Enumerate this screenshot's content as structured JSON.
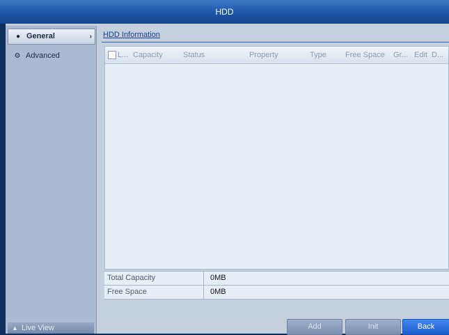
{
  "window": {
    "title": "HDD"
  },
  "sidebar": {
    "items": [
      {
        "label": "General",
        "icon": "dot-icon",
        "active": true
      },
      {
        "label": "Advanced",
        "icon": "gear-icon",
        "active": false
      }
    ],
    "live_view": {
      "label": "Live View",
      "icon": "home-icon"
    }
  },
  "main": {
    "section_tab": "HDD Information",
    "table": {
      "columns": [
        "L...",
        "Capacity",
        "Status",
        "Property",
        "Type",
        "Free Space",
        "Gr...",
        "Edit",
        "D..."
      ],
      "rows": []
    },
    "summary": [
      {
        "label": "Total Capacity",
        "value": "0MB"
      },
      {
        "label": "Free Space",
        "value": "0MB"
      }
    ]
  },
  "buttons": {
    "add": "Add",
    "init": "Init",
    "back": "Back"
  },
  "colors": {
    "accent": "#1d5fd0",
    "titlebar": "#1f57a9"
  }
}
